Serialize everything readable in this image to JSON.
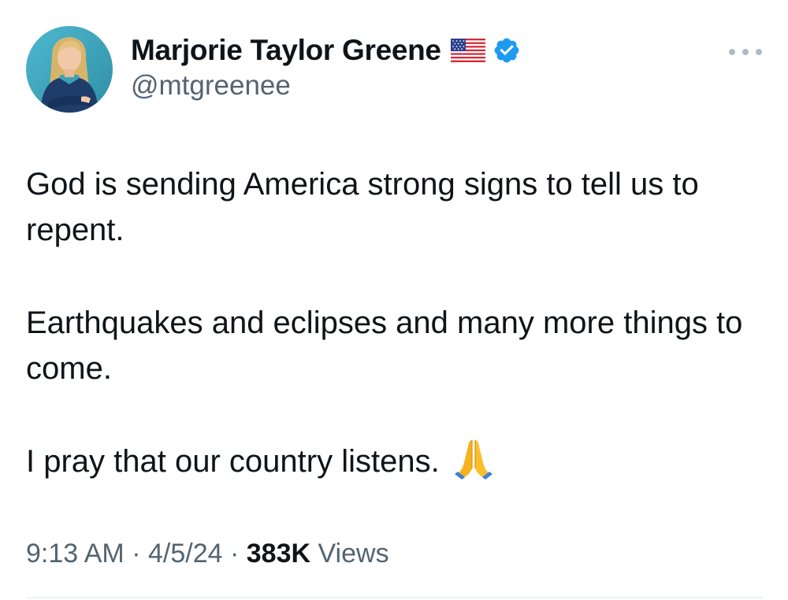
{
  "author": {
    "display_name": "Marjorie Taylor Greene",
    "handle": "@mtgreenee",
    "flag_icon": "us-flag-emoji",
    "verified_icon": "verified-badge-icon",
    "verified_color": "#1d9bf0"
  },
  "tweet": {
    "paragraphs": [
      "God is sending America strong signs to tell us to repent.",
      "Earthquakes and eclipses and many more things to come.",
      "I pray that our country listens."
    ],
    "trailing_emoji": "folded-hands-emoji"
  },
  "meta": {
    "time": "9:13 AM",
    "separator": "·",
    "date": "4/5/24",
    "views_count": "383K",
    "views_label": "Views"
  },
  "colors": {
    "text_primary": "#0f1419",
    "text_secondary": "#536471",
    "avatar_bg": "#3aa6bd"
  }
}
